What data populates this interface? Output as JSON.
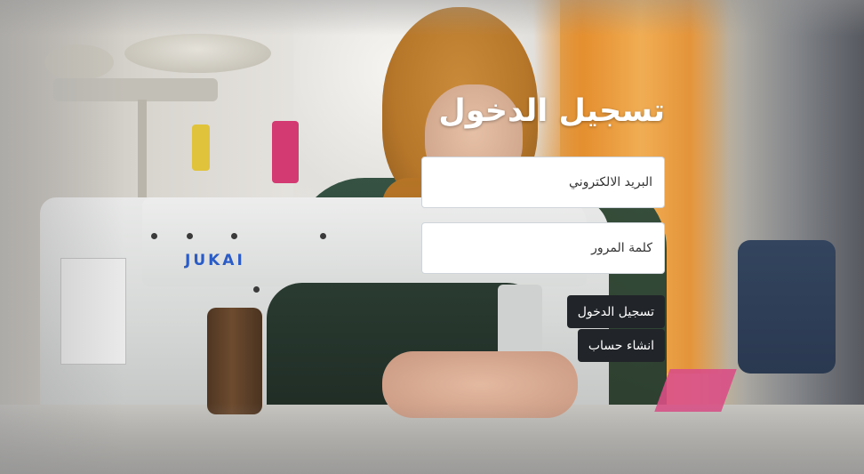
{
  "login": {
    "title": "تسجيل الدخول",
    "email_placeholder": "البريد الالكتروني",
    "password_placeholder": "كلمة المرور",
    "login_button": "تسجيل الدخول",
    "register_button": "انشاء حساب"
  },
  "background": {
    "machine_brand": "JUKAI"
  },
  "colors": {
    "button_bg": "#212529",
    "button_text": "#ffffff",
    "title_text": "#ffffff",
    "input_bg": "#ffffff",
    "input_border": "#ced4da"
  }
}
